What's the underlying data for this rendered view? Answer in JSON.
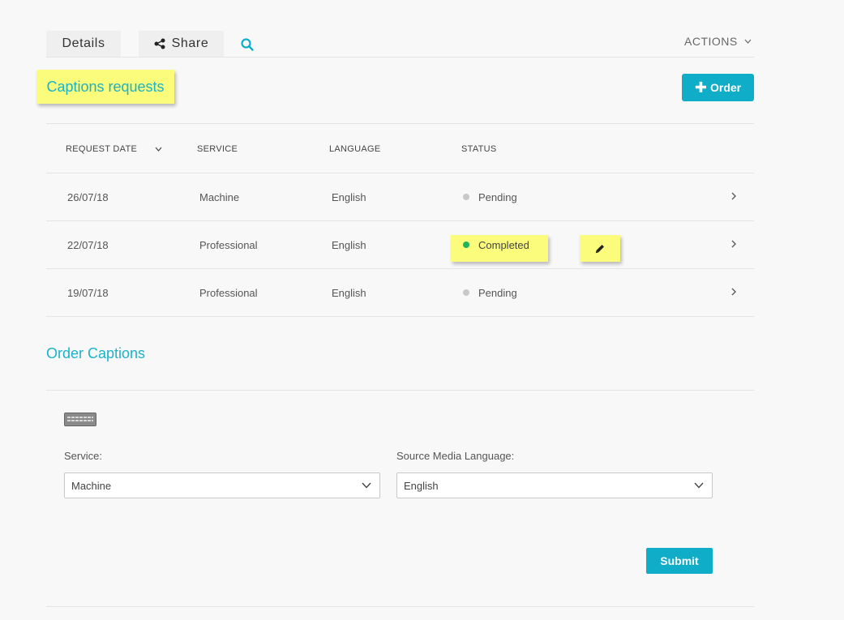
{
  "tabs": {
    "details_label": "Details",
    "share_label": "Share"
  },
  "actions_label": "ACTIONS",
  "captions": {
    "title": "Captions requests",
    "order_button": "Order",
    "columns": {
      "request_date": "REQUEST DATE",
      "service": "SERVICE",
      "language": "LANGUAGE",
      "status": "STATUS"
    },
    "rows": [
      {
        "date": "26/07/18",
        "service": "Machine",
        "language": "English",
        "status": "Pending",
        "status_color": "#c8c8c8"
      },
      {
        "date": "22/07/18",
        "service": "Professional",
        "language": "English",
        "status": "Completed",
        "status_color": "#1fb35c"
      },
      {
        "date": "19/07/18",
        "service": "Professional",
        "language": "English",
        "status": "Pending",
        "status_color": "#c8c8c8"
      }
    ]
  },
  "order_form": {
    "title": "Order Captions",
    "service_label": "Service:",
    "service_value": "Machine",
    "language_label": "Source Media Language:",
    "language_value": "English",
    "submit_label": "Submit"
  },
  "colors": {
    "accent": "#10adc9",
    "title": "#1bb3c8",
    "highlight": "#fbfb7c"
  },
  "icons": [
    "share-icon",
    "search-icon",
    "chevron-down-icon",
    "plus-icon",
    "chevron-right-icon",
    "pencil-icon",
    "keyboard-icon"
  ]
}
